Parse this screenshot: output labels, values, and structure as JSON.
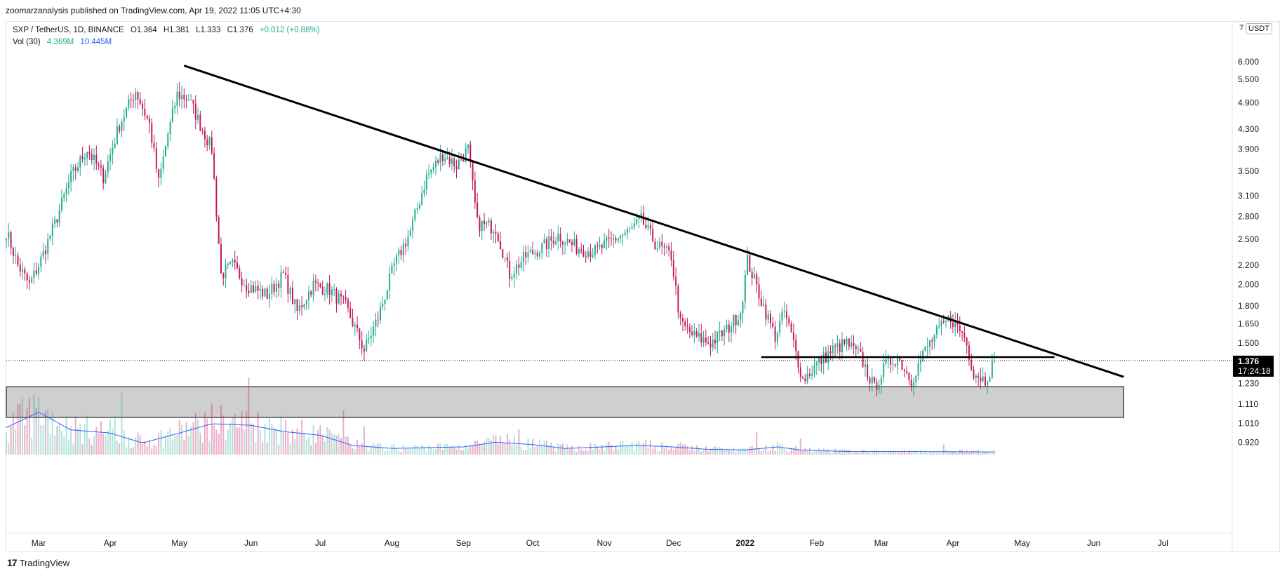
{
  "header": {
    "publisher": "zoomarzanalysis published on TradingView.com, Apr 19, 2022 11:05 UTC+4:30"
  },
  "legend": {
    "symbol": "SXP / TetherUS, 1D, BINANCE",
    "open": "O1.364",
    "high": "H1.381",
    "low": "L1.333",
    "close": "C1.376",
    "change": "+0.012 (+0.88%)",
    "vol_label": "Vol (30)",
    "vol_value": "4.369M",
    "vol_ma": "10.445M"
  },
  "currency_badge": "USDT",
  "scale_cut_label": "7",
  "price_tag": {
    "price": "1.376",
    "countdown": "17:24:18"
  },
  "footer": {
    "brand": "TradingView",
    "logo": "17"
  },
  "colors": {
    "up": "#22ab94",
    "down": "#c2185b",
    "volume_ma": "#2962ff",
    "zone_fill": "#cfcfcf",
    "line": "#000000"
  },
  "chart_data": {
    "type": "candlestick",
    "title": "SXP / TetherUS, 1D, BINANCE",
    "y_scale": "log",
    "ylim": [
      0.86,
      7.3
    ],
    "y_ticks": [
      "6.000",
      "5.500",
      "4.900",
      "4.300",
      "3.900",
      "3.500",
      "3.100",
      "2.800",
      "2.500",
      "2.200",
      "2.000",
      "1.800",
      "1.650",
      "1.500",
      "1.376",
      "1.230",
      "1.110",
      "1.010",
      "0.920"
    ],
    "x_range": [
      "2021-02-15",
      "2022-07-31"
    ],
    "x_ticks": [
      "Mar",
      "Apr",
      "May",
      "Jun",
      "Jul",
      "Aug",
      "Sep",
      "Oct",
      "Nov",
      "Dec",
      "2022",
      "Feb",
      "Mar",
      "Apr",
      "May",
      "Jun",
      "Jul"
    ],
    "x_tick_dates": [
      "2021-03-01",
      "2021-04-01",
      "2021-05-01",
      "2021-06-01",
      "2021-07-01",
      "2021-08-01",
      "2021-09-01",
      "2021-10-01",
      "2021-11-01",
      "2021-12-01",
      "2022-01-01",
      "2022-02-01",
      "2022-03-01",
      "2022-04-01",
      "2022-05-01",
      "2022-06-01",
      "2022-07-01"
    ],
    "price_path": [
      [
        "2021-02-15",
        2.6
      ],
      [
        "2021-02-20",
        2.2
      ],
      [
        "2021-02-25",
        2.0
      ],
      [
        "2021-03-01",
        2.2
      ],
      [
        "2021-03-08",
        2.7
      ],
      [
        "2021-03-15",
        3.4
      ],
      [
        "2021-03-22",
        3.9
      ],
      [
        "2021-03-29",
        3.4
      ],
      [
        "2021-04-05",
        4.4
      ],
      [
        "2021-04-12",
        5.2
      ],
      [
        "2021-04-18",
        4.4
      ],
      [
        "2021-04-22",
        3.3
      ],
      [
        "2021-04-26",
        4.2
      ],
      [
        "2021-04-30",
        5.1
      ],
      [
        "2021-05-05",
        5.0
      ],
      [
        "2021-05-10",
        4.4
      ],
      [
        "2021-05-15",
        3.9
      ],
      [
        "2021-05-19",
        2.1
      ],
      [
        "2021-05-24",
        2.2
      ],
      [
        "2021-05-30",
        2.0
      ],
      [
        "2021-06-08",
        1.9
      ],
      [
        "2021-06-15",
        2.1
      ],
      [
        "2021-06-21",
        1.75
      ],
      [
        "2021-06-28",
        2.0
      ],
      [
        "2021-07-05",
        1.95
      ],
      [
        "2021-07-12",
        1.8
      ],
      [
        "2021-07-20",
        1.45
      ],
      [
        "2021-07-26",
        1.7
      ],
      [
        "2021-08-02",
        2.2
      ],
      [
        "2021-08-09",
        2.6
      ],
      [
        "2021-08-16",
        3.4
      ],
      [
        "2021-08-23",
        3.8
      ],
      [
        "2021-08-29",
        3.6
      ],
      [
        "2021-09-03",
        3.9
      ],
      [
        "2021-09-07",
        2.7
      ],
      [
        "2021-09-15",
        2.65
      ],
      [
        "2021-09-21",
        2.1
      ],
      [
        "2021-09-28",
        2.3
      ],
      [
        "2021-10-05",
        2.4
      ],
      [
        "2021-10-12",
        2.55
      ],
      [
        "2021-10-20",
        2.4
      ],
      [
        "2021-10-28",
        2.35
      ],
      [
        "2021-11-05",
        2.5
      ],
      [
        "2021-11-12",
        2.6
      ],
      [
        "2021-11-17",
        2.75
      ],
      [
        "2021-11-23",
        2.45
      ],
      [
        "2021-11-30",
        2.3
      ],
      [
        "2021-12-04",
        1.65
      ],
      [
        "2021-12-10",
        1.55
      ],
      [
        "2021-12-17",
        1.5
      ],
      [
        "2021-12-24",
        1.6
      ],
      [
        "2021-12-30",
        1.75
      ],
      [
        "2022-01-02",
        2.25
      ],
      [
        "2022-01-08",
        1.85
      ],
      [
        "2022-01-14",
        1.55
      ],
      [
        "2022-01-18",
        1.75
      ],
      [
        "2022-01-22",
        1.5
      ],
      [
        "2022-01-26",
        1.25
      ],
      [
        "2022-02-01",
        1.35
      ],
      [
        "2022-02-08",
        1.45
      ],
      [
        "2022-02-14",
        1.5
      ],
      [
        "2022-02-20",
        1.4
      ],
      [
        "2022-02-26",
        1.2
      ],
      [
        "2022-03-03",
        1.35
      ],
      [
        "2022-03-08",
        1.4
      ],
      [
        "2022-03-14",
        1.25
      ],
      [
        "2022-03-20",
        1.45
      ],
      [
        "2022-03-26",
        1.6
      ],
      [
        "2022-03-31",
        1.7
      ],
      [
        "2022-04-06",
        1.55
      ],
      [
        "2022-04-10",
        1.3
      ],
      [
        "2022-04-15",
        1.25
      ],
      [
        "2022-04-19",
        1.376
      ]
    ],
    "volume_ma_path": [
      [
        "2021-02-15",
        0.35
      ],
      [
        "2021-03-01",
        0.55
      ],
      [
        "2021-03-15",
        0.32
      ],
      [
        "2021-04-01",
        0.28
      ],
      [
        "2021-04-15",
        0.15
      ],
      [
        "2021-05-01",
        0.28
      ],
      [
        "2021-05-15",
        0.4
      ],
      [
        "2021-06-01",
        0.38
      ],
      [
        "2021-06-15",
        0.3
      ],
      [
        "2021-07-01",
        0.25
      ],
      [
        "2021-07-15",
        0.12
      ],
      [
        "2021-08-01",
        0.08
      ],
      [
        "2021-08-15",
        0.09
      ],
      [
        "2021-09-01",
        0.1
      ],
      [
        "2021-09-15",
        0.16
      ],
      [
        "2021-10-01",
        0.13
      ],
      [
        "2021-10-15",
        0.08
      ],
      [
        "2021-11-01",
        0.1
      ],
      [
        "2021-11-15",
        0.12
      ],
      [
        "2021-12-01",
        0.1
      ],
      [
        "2021-12-15",
        0.07
      ],
      [
        "2022-01-01",
        0.06
      ],
      [
        "2022-01-15",
        0.1
      ],
      [
        "2022-01-25",
        0.06
      ],
      [
        "2022-02-15",
        0.04
      ],
      [
        "2022-03-15",
        0.04
      ],
      [
        "2022-04-19",
        0.035
      ]
    ],
    "drawings": {
      "descending_trendline": {
        "from": [
          "2021-05-03",
          5.88
        ],
        "to": [
          "2022-06-14",
          1.27
        ]
      },
      "horizontal_support": {
        "from": [
          "2022-01-08",
          1.4
        ],
        "to": [
          "2022-05-15",
          1.4
        ],
        "price": 1.4
      },
      "demand_zone": {
        "from_date": "2021-02-15",
        "to_date": "2022-06-14",
        "price_low": 1.04,
        "price_high": 1.21
      }
    },
    "grid": false
  }
}
